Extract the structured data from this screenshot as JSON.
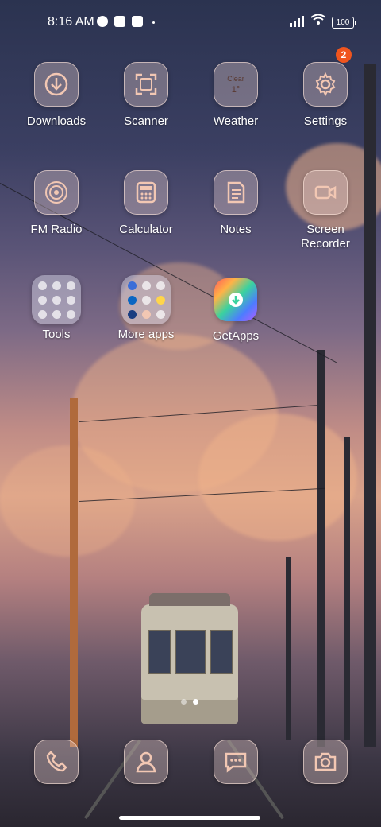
{
  "status_bar": {
    "time": "8:16 AM",
    "battery": "100",
    "icons": [
      "data-saver-icon",
      "square-notification-icon",
      "upload-icon",
      "signal-icon",
      "wifi-icon",
      "battery-icon"
    ]
  },
  "apps": {
    "downloads": "Downloads",
    "scanner": "Scanner",
    "weather": "Weather",
    "weather_condition": "Clear",
    "weather_temp": "1°",
    "settings": "Settings",
    "settings_badge": "2",
    "fm_radio": "FM Radio",
    "calculator": "Calculator",
    "notes": "Notes",
    "screen_recorder": "Screen Recorder",
    "tools": "Tools",
    "more_apps": "More apps",
    "getapps": "GetApps"
  },
  "dock": {
    "items": [
      "phone-icon",
      "contacts-icon",
      "messages-icon",
      "camera-icon"
    ]
  },
  "pager": {
    "pages": 2,
    "current": 2
  },
  "colors": {
    "icon_stroke": "#f2c7b3",
    "badge": "#f0551e"
  }
}
